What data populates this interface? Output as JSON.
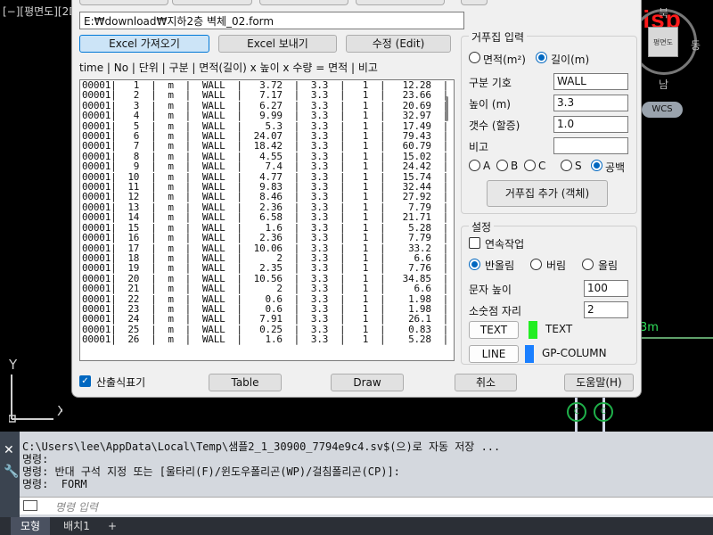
{
  "cad": {
    "view_label": "[−][평면도][2D",
    "brand": "LEE Lisp",
    "viewcube_label": "평면도",
    "compass": {
      "north": "북",
      "east": "동",
      "south": "남"
    },
    "wcs": "WCS",
    "green_label": "3m",
    "ucs_x": "X",
    "ucs_y": "Y"
  },
  "dialog": {
    "path": "E:₩download₩지하2층 벽체_02.form",
    "buttons": {
      "excel_import": "Excel 가져오기",
      "excel_export": "Excel 보내기",
      "edit": "수정 (Edit)",
      "add_object": "거푸집 추가 (객체)",
      "table": "Table",
      "draw": "Draw",
      "cancel": "취소",
      "help": "도움말(H)",
      "text": "TEXT",
      "line": "LINE"
    },
    "columns_header": "time | No | 단위 | 구분 | 면적(길이) x 높이 x 수량 = 면적 | 비고",
    "rows": [
      "00001|   1  |  m  |  WALL  |   3.72  |  3.3  |   1  |   12.28  |   |",
      "00001|   2  |  m  |  WALL  |   7.17  |  3.3  |   1  |   23.66  |   |",
      "00001|   3  |  m  |  WALL  |   6.27  |  3.3  |   1  |   20.69  |   |",
      "00001|   4  |  m  |  WALL  |   9.99  |  3.3  |   1  |   32.97  |   |",
      "00001|   5  |  m  |  WALL  |    5.3  |  3.3  |   1  |   17.49  |   |",
      "00001|   6  |  m  |  WALL  |  24.07  |  3.3  |   1  |   79.43  |   |",
      "00001|   7  |  m  |  WALL  |  18.42  |  3.3  |   1  |   60.79  |   |",
      "00001|   8  |  m  |  WALL  |   4.55  |  3.3  |   1  |   15.02  |   |",
      "00001|   9  |  m  |  WALL  |    7.4  |  3.3  |   1  |   24.42  |   |",
      "00001|  10  |  m  |  WALL  |   4.77  |  3.3  |   1  |   15.74  |   |",
      "00001|  11  |  m  |  WALL  |   9.83  |  3.3  |   1  |   32.44  |   |",
      "00001|  12  |  m  |  WALL  |   8.46  |  3.3  |   1  |   27.92  |   |",
      "00001|  13  |  m  |  WALL  |   2.36  |  3.3  |   1  |    7.79  |   |",
      "00001|  14  |  m  |  WALL  |   6.58  |  3.3  |   1  |   21.71  |   |",
      "00001|  15  |  m  |  WALL  |    1.6  |  3.3  |   1  |    5.28  |   |",
      "00001|  16  |  m  |  WALL  |   2.36  |  3.3  |   1  |    7.79  |   |",
      "00001|  17  |  m  |  WALL  |  10.06  |  3.3  |   1  |    33.2  |   |",
      "00001|  18  |  m  |  WALL  |      2  |  3.3  |   1  |     6.6  |   |",
      "00001|  19  |  m  |  WALL  |   2.35  |  3.3  |   1  |    7.76  |   |",
      "00001|  20  |  m  |  WALL  |  10.56  |  3.3  |   1  |   34.85  |   |",
      "00001|  21  |  m  |  WALL  |      2  |  3.3  |   1  |     6.6  |   |",
      "00001|  22  |  m  |  WALL  |    0.6  |  3.3  |   1  |    1.98  |   |",
      "00001|  23  |  m  |  WALL  |    0.6  |  3.3  |   1  |    1.98  |   |",
      "00001|  24  |  m  |  WALL  |   7.91  |  3.3  |   1  |    26.1  |   |",
      "00001|  25  |  m  |  WALL  |   0.25  |  3.3  |   1  |    0.83  |   |",
      "00001|  26  |  m  |  WALL  |    1.6  |  3.3  |   1  |    5.28  |   |"
    ],
    "formwork": {
      "title": "거푸집 입력",
      "radio_area": "면적(m²)",
      "radio_length": "길이(m)",
      "label_code": "구분 기호",
      "value_code": "WALL",
      "label_height": "높이 (m)",
      "value_height": "3.3",
      "label_count": "갯수 (할증)",
      "value_count": "1.0",
      "label_note": "비고",
      "value_note": "",
      "type_options": [
        "A",
        "B",
        "C",
        "S",
        "공백"
      ],
      "type_selected": "공백"
    },
    "settings": {
      "title": "설정",
      "continuous": "연속작업",
      "round_options": [
        "반올림",
        "버림",
        "올림"
      ],
      "round_selected": "반올림",
      "label_text_height": "문자 높이",
      "value_text_height": "100",
      "label_decimals": "소숫점 자리",
      "value_decimals": "2",
      "text_layer": "TEXT",
      "line_layer": "GP-COLUMN",
      "text_color": "#22ee22",
      "line_color": "#1a7fff"
    },
    "show_formula_label": "산출식표기",
    "show_formula_checked": true
  },
  "command": {
    "lines": [
      "C:\\Users\\lee\\AppData\\Local\\Temp\\샘플2_1_30900_7794e9c4.sv$(으)로 자동 저장 ...",
      "명령:",
      "명령: 반대 구석 지정 또는 [울타리(F)/윈도우폴리곤(WP)/걸침폴리곤(CP)]:",
      "명령:  FORM"
    ],
    "placeholder": "명령 입력"
  },
  "tabs": [
    "모형",
    "배치1",
    "+"
  ]
}
